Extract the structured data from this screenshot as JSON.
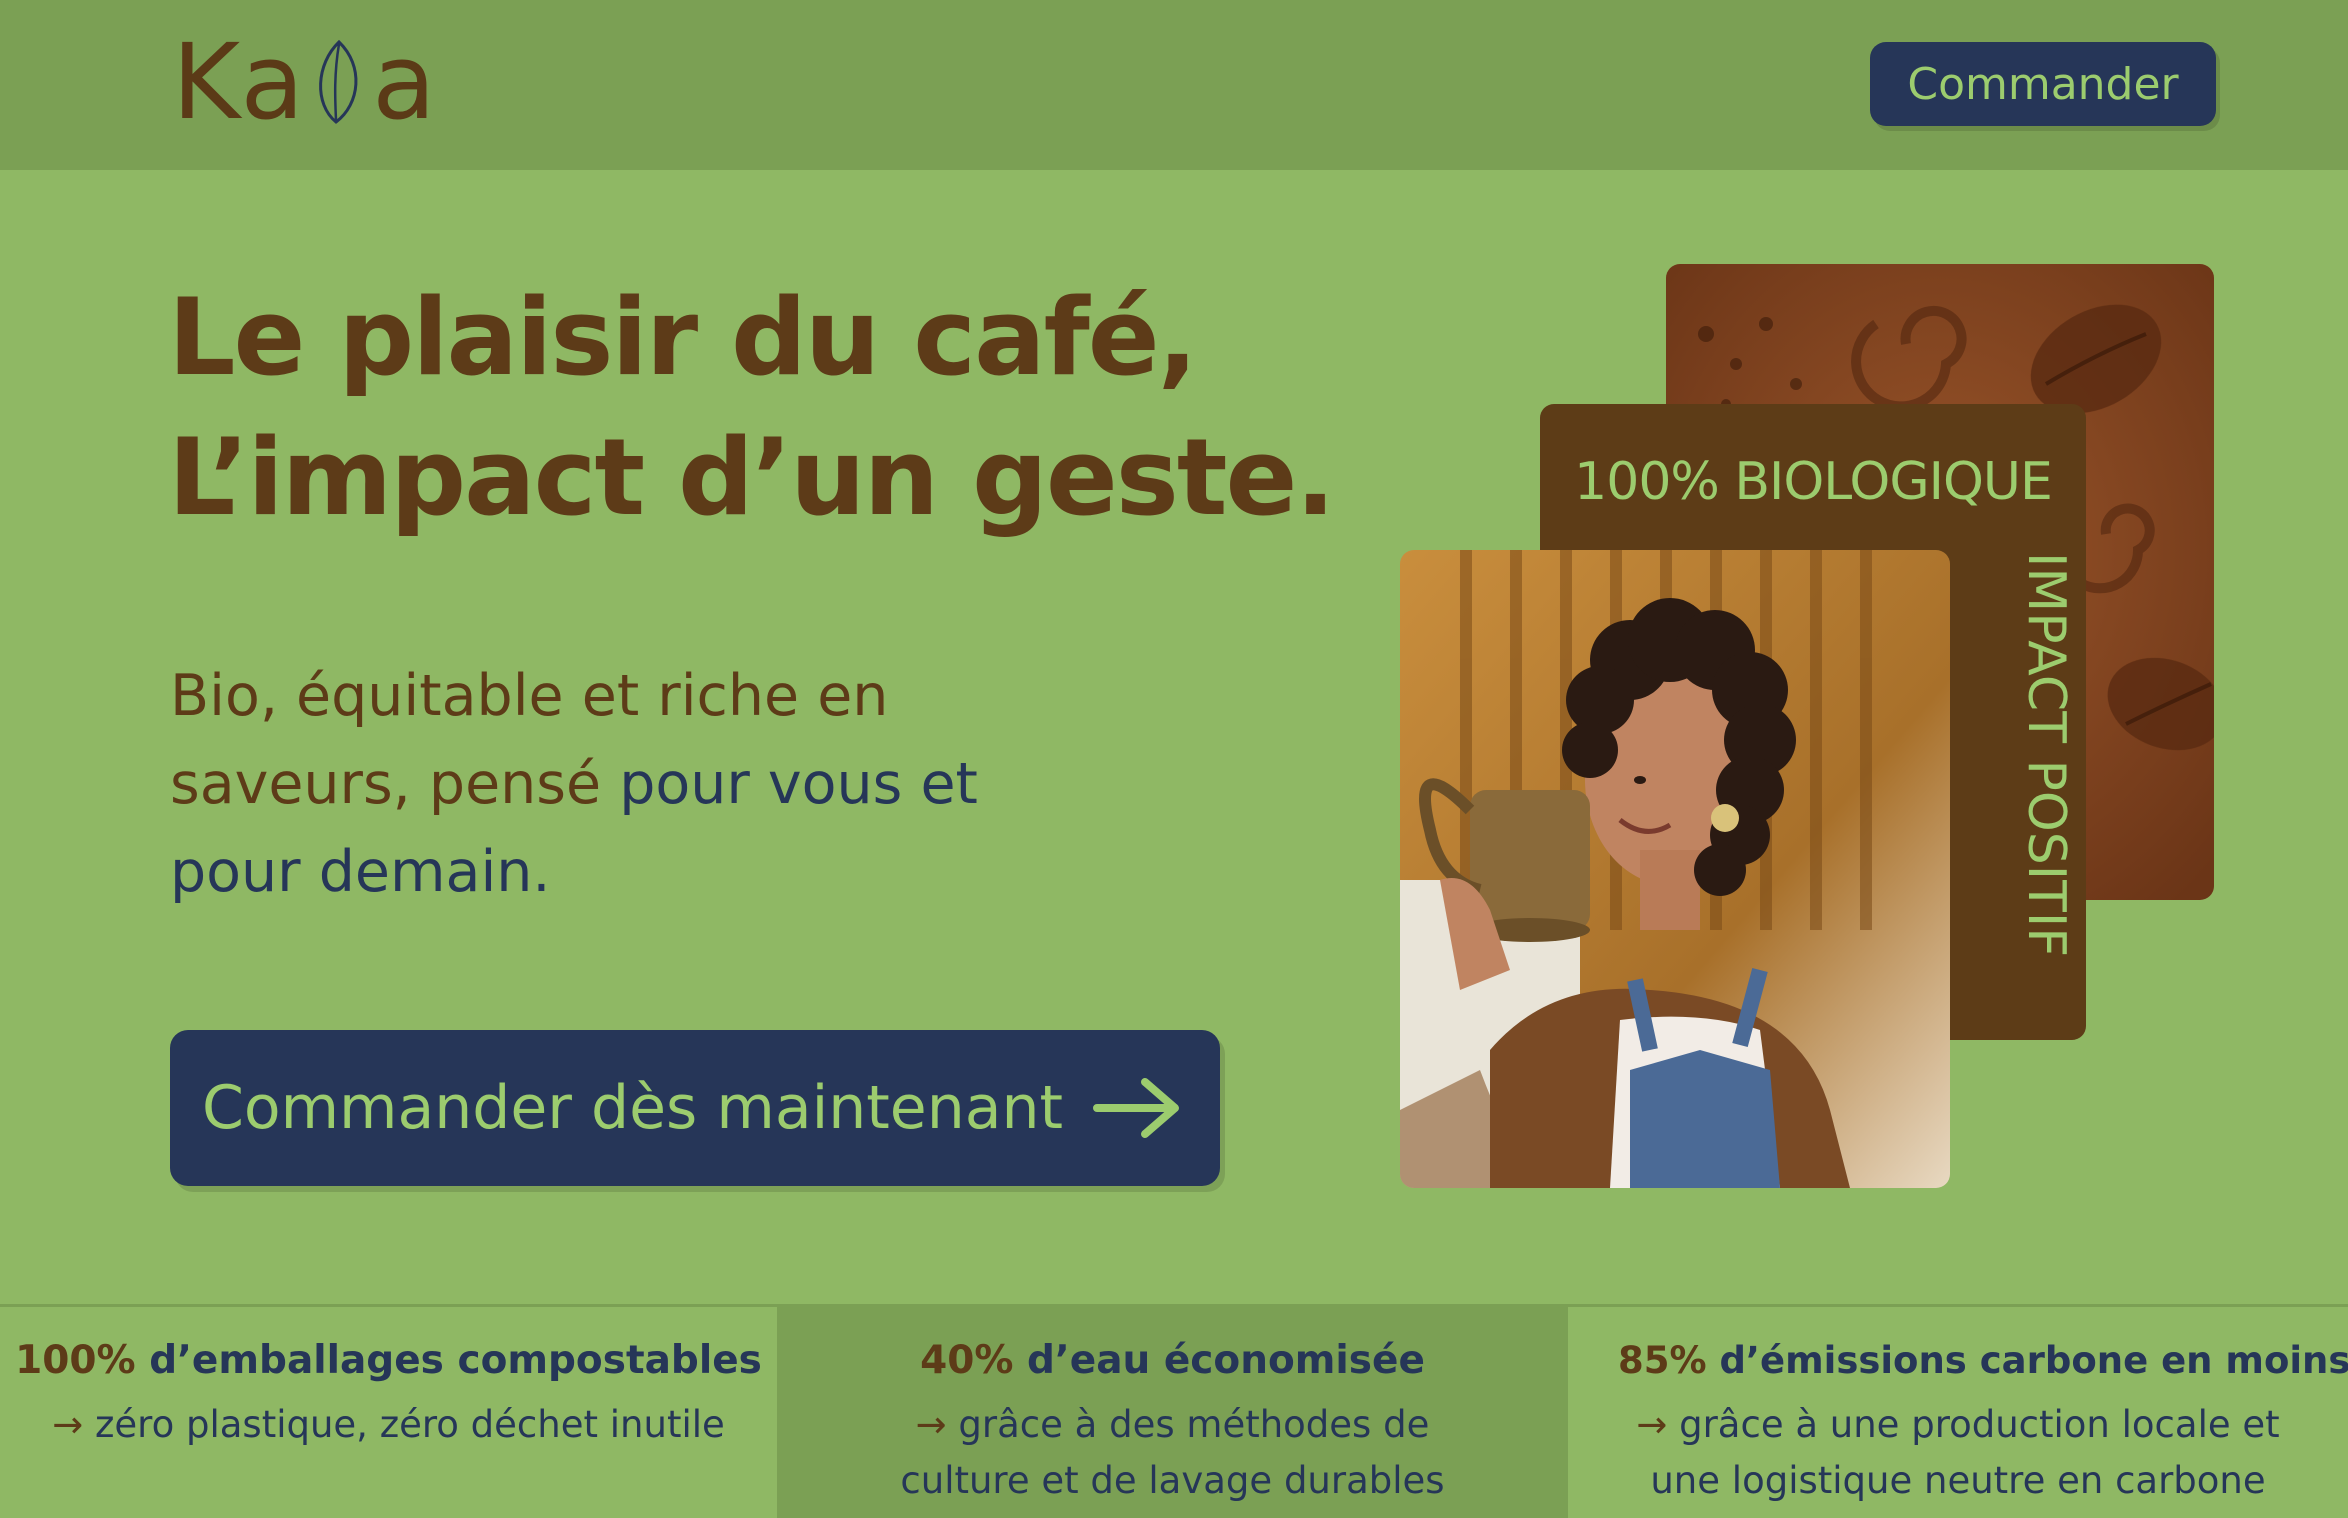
{
  "header": {
    "logo_text_start": "Ka",
    "logo_text_end": "a",
    "order_button": "Commander"
  },
  "hero": {
    "title_line_1": "Le plaisir du café,",
    "title_line_2": "L’impact d’un geste.",
    "subtitle_part_1": "Bio, équitable et riche en saveurs, pensé ",
    "subtitle_part_2": "pour vous et pour demain.",
    "cta_label": "Commander dès maintenant"
  },
  "visual": {
    "label_bio": "100% BIOLOGIQUE",
    "label_impact": "IMPACT POSITIF"
  },
  "stats": [
    {
      "value": "100%",
      "title": " d’emballages compostables",
      "arrow": "→",
      "desc": " zéro plastique, zéro déchet inutile"
    },
    {
      "value": "40%",
      "title": " d’eau économisée",
      "arrow": "→",
      "desc": " grâce à des méthodes de culture et de lavage durables"
    },
    {
      "value": "85%",
      "title": " d’émissions carbone en moins",
      "arrow": "→",
      "desc": " grâce à une production locale et une logistique neutre en carbone"
    }
  ],
  "colors": {
    "page_bg": "#8fb864",
    "header_bg": "#7ba054",
    "brown": "#5d3b18",
    "navy": "#263658",
    "light_green": "#9ccc6e"
  }
}
